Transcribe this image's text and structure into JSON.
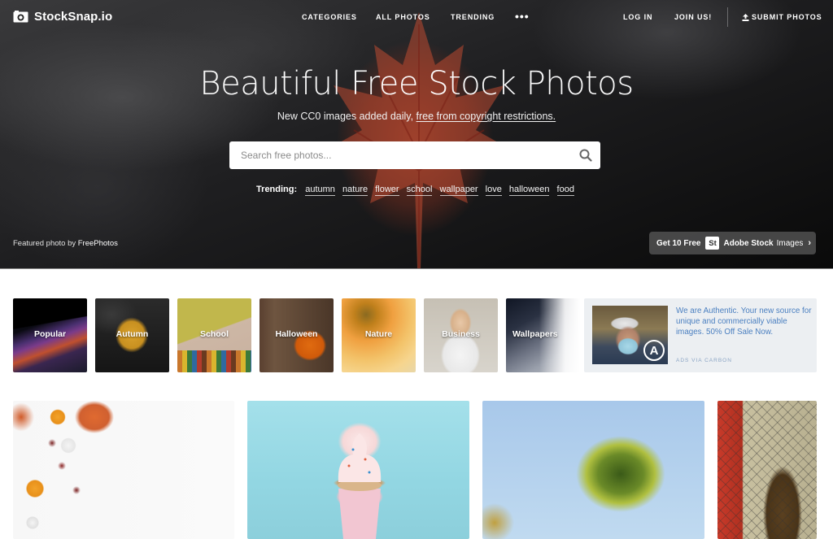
{
  "brand": {
    "name": "StockSnap.io",
    "icon": "camera-icon"
  },
  "nav": {
    "center_links": [
      "CATEGORIES",
      "ALL PHOTOS",
      "TRENDING"
    ],
    "more": "•••",
    "login": "LOG IN",
    "join": "JOIN US!",
    "submit": "SUBMIT PHOTOS",
    "submit_icon": "upload-icon"
  },
  "hero": {
    "title": "Beautiful Free Stock Photos",
    "subtitle_prefix": "New CC0 images added daily, ",
    "subtitle_link": "free from copyright restrictions.",
    "search": {
      "placeholder": "Search free photos...",
      "value": "",
      "icon": "search-icon"
    },
    "trending_label": "Trending:",
    "trending_tags": [
      "autumn",
      "nature",
      "flower",
      "school",
      "wallpaper",
      "love",
      "halloween",
      "food"
    ],
    "featured_prefix": "Featured photo by ",
    "featured_author": "FreePhotos",
    "adobe": {
      "prefix": "Get 10 Free",
      "badge": "St",
      "brand": "Adobe Stock",
      "suffix": "Images",
      "chevron": "›"
    }
  },
  "categories": [
    "Popular",
    "Autumn",
    "School",
    "Halloween",
    "Nature",
    "Business",
    "Wallpapers"
  ],
  "ad": {
    "text": "We are Authentic. Your new source for unique and commercially viable images. 50% Off Sale Now.",
    "via": "ADS VIA CARBON",
    "logo": "A"
  },
  "colors": {
    "ad_text": "#4a7fc0",
    "ad_bg": "#eceff2"
  },
  "photos": [
    {
      "subject": "autumn pumpkins flat lay"
    },
    {
      "subject": "pink cupcake on blue"
    },
    {
      "subject": "palm tree against sky"
    },
    {
      "subject": "woman by chain-link fence"
    }
  ]
}
